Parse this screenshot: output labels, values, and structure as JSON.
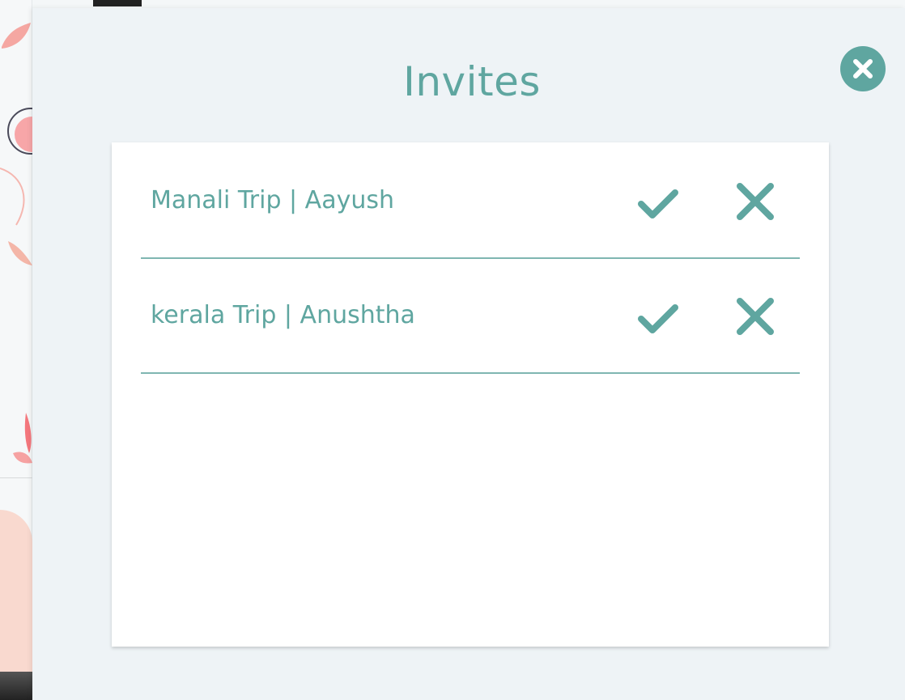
{
  "modal": {
    "title": "Invites",
    "close_icon": "close-circle-icon",
    "accent_color": "#5fa6a0"
  },
  "invites": [
    {
      "label": "Manali Trip | Aayush",
      "accept_icon": "check-icon",
      "reject_icon": "x-icon"
    },
    {
      "label": "kerala Trip | Anushtha",
      "accept_icon": "check-icon",
      "reject_icon": "x-icon"
    }
  ]
}
